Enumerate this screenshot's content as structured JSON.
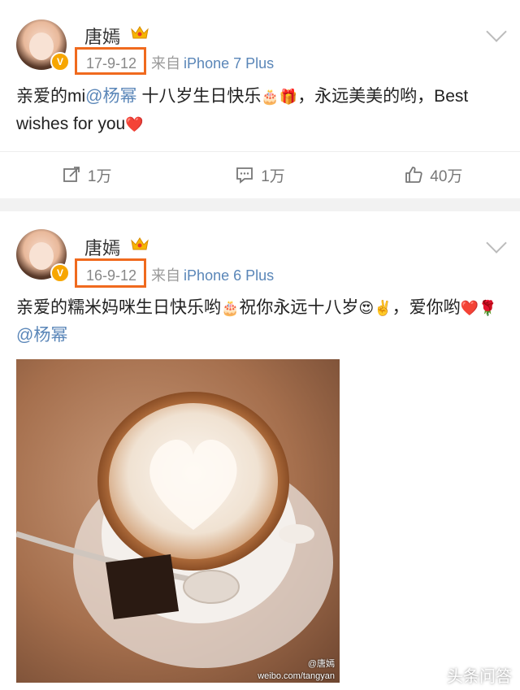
{
  "posts": [
    {
      "author": "唐嫣",
      "date": "17-9-12",
      "from": "来自",
      "device": "iPhone 7 Plus",
      "text_before": "亲爱的mi",
      "mention": "@杨幂",
      "text_mid": " 十八岁生日快乐",
      "emoji_1": "🎂",
      "emoji_2": "🎁",
      "text_after": "，永远美美的哟，Best wishes for you",
      "emoji_3": "❤️",
      "repost_count": "1万",
      "comment_count": "1万",
      "like_count": "40万"
    },
    {
      "author": "唐嫣",
      "date": "16-9-12",
      "from": "来自",
      "device": "iPhone 6 Plus",
      "text_before": "亲爱的糯米妈咪生日快乐哟",
      "emoji_1": "🎂",
      "text_mid": "祝你永远十八岁",
      "emoji_2": "😍",
      "emoji_3": "✌️",
      "text_after": "，爱你哟",
      "emoji_4": "❤️",
      "emoji_5": "🌹",
      "mention": "@杨幂",
      "image_watermark_line1": "@唐嫣",
      "image_watermark_line2": "weibo.com/tangyan"
    }
  ],
  "corner_watermark": "头条问答",
  "colors": {
    "highlight": "#f06a1e",
    "link": "#5a86b8",
    "badge": "#f7a600"
  }
}
